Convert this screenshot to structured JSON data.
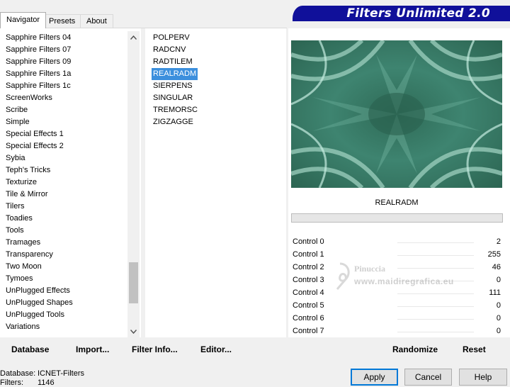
{
  "tabs": [
    {
      "label": "Navigator",
      "active": true
    },
    {
      "label": "Presets",
      "active": false
    },
    {
      "label": "About",
      "active": false
    }
  ],
  "banner": {
    "title": "Filters Unlimited 2.0",
    "color": "#10109a"
  },
  "categories": [
    "Sapphire Filters 04",
    "Sapphire Filters 07",
    "Sapphire Filters 09",
    "Sapphire Filters 1a",
    "Sapphire Filters 1c",
    "ScreenWorks",
    "Scribe",
    "Simple",
    "Special Effects 1",
    "Special Effects 2",
    "Sybia",
    "Teph's Tricks",
    "Texturize",
    "Tile & Mirror",
    "Tilers",
    "Toadies",
    "Tools",
    "Tramages",
    "Transparency",
    "Two Moon",
    "Tymoes",
    "UnPlugged Effects",
    "UnPlugged Shapes",
    "UnPlugged Tools",
    "Variations"
  ],
  "filters": [
    {
      "label": "POLPERV",
      "selected": false
    },
    {
      "label": "RADCNV",
      "selected": false
    },
    {
      "label": "RADTILEM",
      "selected": false
    },
    {
      "label": "REALRADM",
      "selected": true
    },
    {
      "label": "SIERPENS",
      "selected": false
    },
    {
      "label": "SINGULAR",
      "selected": false
    },
    {
      "label": "TREMORSC",
      "selected": false
    },
    {
      "label": "ZIGZAGGE",
      "selected": false
    }
  ],
  "selection_color": "#3c8fdd",
  "filter_name": "REALRADM",
  "controls": [
    {
      "label": "Control 0",
      "value": "2"
    },
    {
      "label": "Control 1",
      "value": "255"
    },
    {
      "label": "Control 2",
      "value": "46"
    },
    {
      "label": "Control 3",
      "value": "0"
    },
    {
      "label": "Control 4",
      "value": "111"
    },
    {
      "label": "Control 5",
      "value": "0"
    },
    {
      "label": "Control 6",
      "value": "0"
    },
    {
      "label": "Control 7",
      "value": "0"
    }
  ],
  "watermark": {
    "name": "Pinuccia",
    "site": "www.maidiregrafica.eu"
  },
  "toolbar": {
    "database": "Database",
    "import": "Import...",
    "filter_info": "Filter Info...",
    "editor": "Editor...",
    "randomize": "Randomize",
    "reset": "Reset"
  },
  "status": {
    "database_label": "Database:",
    "database_value": "ICNET-Filters",
    "filters_label": "Filters:",
    "filters_value": "1146"
  },
  "buttons": {
    "apply": "Apply",
    "cancel": "Cancel",
    "help": "Help"
  },
  "icons": {
    "scroll_up": "chevron-up-icon",
    "scroll_down": "chevron-down-icon"
  }
}
